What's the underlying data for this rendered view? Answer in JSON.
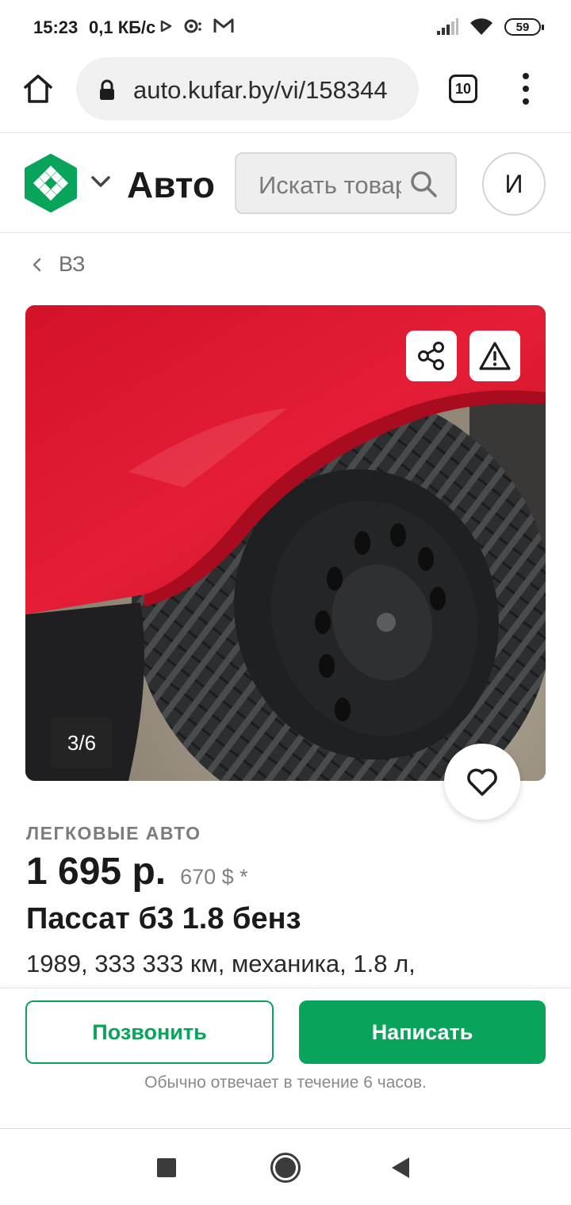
{
  "status_bar": {
    "time": "15:23",
    "speed": "0,1 КБ/с",
    "battery": "59"
  },
  "browser": {
    "url": "auto.kufar.by/vi/158344",
    "tab_count": "10"
  },
  "site_header": {
    "title": "Авто",
    "search_placeholder": "Искать товары",
    "avatar_letter": "И",
    "brand_color": "#08a45b"
  },
  "breadcrumb": {
    "label": "ВЗ"
  },
  "photo": {
    "counter": "3/6"
  },
  "listing": {
    "category": "ЛЕГКОВЫЕ АВТО",
    "price": "1 695 р.",
    "price_usd": "670 $ *",
    "title": "Пассат б3 1.8 бенз",
    "params": "1989, 333 333 км, механика, 1.8 л,"
  },
  "actions": {
    "call_label": "Позвонить",
    "write_label": "Написать",
    "reply_note": "Обычно отвечает в течение 6 часов."
  }
}
